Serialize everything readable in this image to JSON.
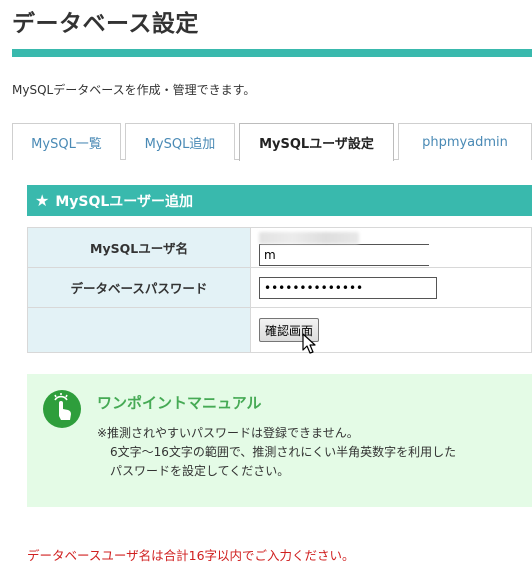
{
  "page": {
    "title": "データベース設定",
    "description": "MySQLデータベースを作成・管理できます。"
  },
  "tabs": [
    {
      "label": "MySQL一覧",
      "active": false
    },
    {
      "label": "MySQL追加",
      "active": false
    },
    {
      "label": "MySQLユーザ設定",
      "active": true
    },
    {
      "label": "phpmyadmin",
      "active": false
    }
  ],
  "section": {
    "icon": "star-icon",
    "title": "MySQLユーザー追加"
  },
  "form": {
    "username_label": "MySQLユーザ名",
    "username_suffix_value": "m",
    "password_label": "データベースパスワード",
    "password_value": "••••••••••••••",
    "confirm_button_label": "確認画面"
  },
  "manual": {
    "icon": "hand-pointer-icon",
    "title": "ワンポイントマニュアル",
    "lines": [
      "※推測されやすいパスワードは登録できません。",
      "6文字～16文字の範囲で、推測されにくい半角英数字を利用した",
      "パスワードを設定してください。"
    ]
  },
  "note": "データベースユーザ名は合計16字以内でご入力ください。",
  "colors": {
    "accent": "#39b9ad",
    "label_bg": "#e3f2f6",
    "manual_bg": "#e4fbe6",
    "manual_title": "#46aa55",
    "error": "#d02020"
  }
}
